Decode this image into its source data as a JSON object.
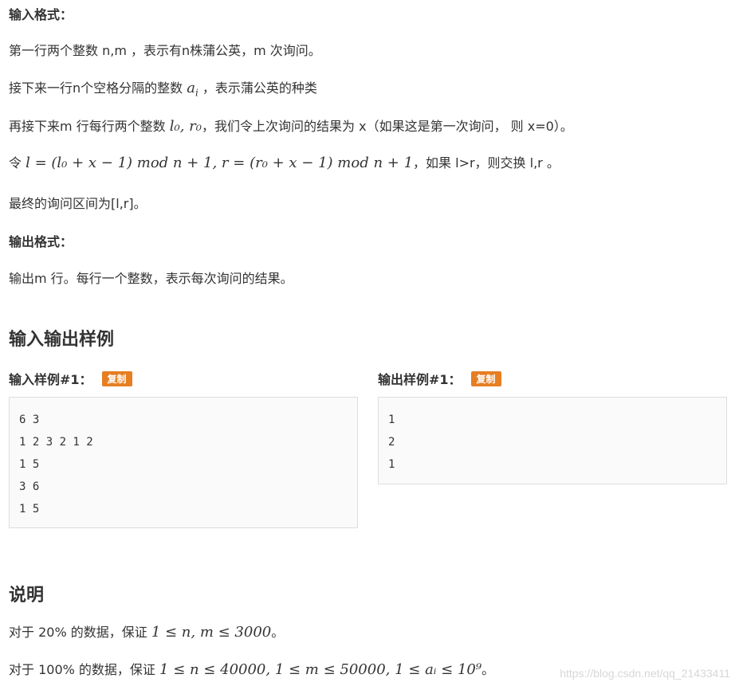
{
  "input_format": {
    "heading": "输入格式：",
    "line1": "第一行两个整数 n,m ，表示有n株蒲公英，m 次询问。",
    "line2_pre": "接下来一行n个空格分隔的整数 ",
    "line2_math": "a",
    "line2_sub": "i",
    "line2_post": " ，表示蒲公英的种类",
    "line3_pre": "再接下来m 行每行两个整数 ",
    "line3_math": "l₀, r₀",
    "line3_post": "，我们令上次询问的结果为 x（如果这是第一次询问， 则 x=0）。",
    "line4_pre": "令 ",
    "line4_math": "l = (l₀ + x − 1) mod n + 1, r = (r₀ + x − 1) mod n + 1",
    "line4_post": "，如果 l>r，则交换 l,r 。",
    "line5": "最终的询问区间为[l,r]。"
  },
  "output_format": {
    "heading": "输出格式：",
    "line1": "输出m 行。每行一个整数，表示每次询问的结果。"
  },
  "samples": {
    "heading": "输入输出样例",
    "input_label": "输入样例#1：",
    "output_label": "输出样例#1：",
    "copy_label": "复制",
    "input_lines": [
      "6 3",
      "1 2 3 2 1 2",
      "1 5",
      "3 6",
      "1 5"
    ],
    "output_lines": [
      "1",
      "2",
      "1"
    ]
  },
  "explanation": {
    "heading": "说明",
    "line1_pre": "对于 20% 的数据，保证 ",
    "line1_math": "1 ≤ n, m ≤ 3000",
    "line1_post": "。",
    "line2_pre": "对于 100% 的数据，保证 ",
    "line2_math": "1 ≤ n ≤ 40000, 1 ≤ m ≤ 50000, 1 ≤ aᵢ ≤ 10⁹",
    "line2_post": "。"
  },
  "watermark": "https://blog.csdn.net/qq_21433411"
}
